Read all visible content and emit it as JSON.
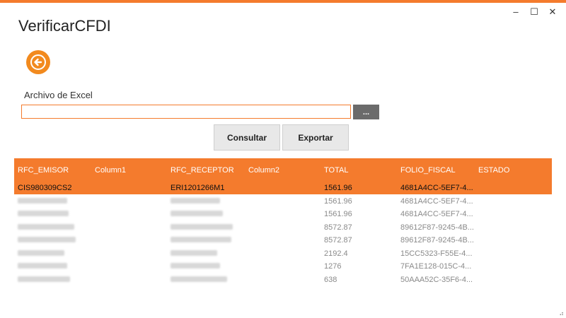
{
  "window": {
    "title": "VerificarCFDI",
    "controls": {
      "minimize": "–",
      "maximize": "☐",
      "close": "✕"
    }
  },
  "accent_color": "#f47b2d",
  "form": {
    "excel_label": "Archivo de Excel",
    "browse_label": "...",
    "consultar_label": "Consultar",
    "exportar_label": "Exportar"
  },
  "grid": {
    "columns": [
      "RFC_EMISOR",
      "Column1",
      "RFC_RECEPTOR",
      "Column2",
      "TOTAL",
      "FOLIO_FISCAL",
      "ESTADO"
    ],
    "rows": [
      {
        "rfc_emisor": "CIS980309CS2",
        "rfc_receptor": "ERI1201266M1",
        "total": "1561.96",
        "folio_fiscal": "4681A4CC-5EF7-4...",
        "selected": true
      },
      {
        "rfc_emisor": "",
        "rfc_receptor": "",
        "total": "1561.96",
        "folio_fiscal": "4681A4CC-5EF7-4..."
      },
      {
        "rfc_emisor": "",
        "rfc_receptor": "",
        "total": "1561.96",
        "folio_fiscal": "4681A4CC-5EF7-4..."
      },
      {
        "rfc_emisor": "",
        "rfc_receptor": "",
        "total": "8572.87",
        "folio_fiscal": "89612F87-9245-4B..."
      },
      {
        "rfc_emisor": "",
        "rfc_receptor": "",
        "total": "8572.87",
        "folio_fiscal": "89612F87-9245-4B..."
      },
      {
        "rfc_emisor": "",
        "rfc_receptor": "",
        "total": "2192.4",
        "folio_fiscal": "15CC5323-F55E-4..."
      },
      {
        "rfc_emisor": "",
        "rfc_receptor": "",
        "total": "1276",
        "folio_fiscal": "7FA1E128-015C-4..."
      },
      {
        "rfc_emisor": "",
        "rfc_receptor": "",
        "total": "638",
        "folio_fiscal": "50AAA52C-35F6-4..."
      }
    ]
  },
  "resize_grip": "⣠"
}
